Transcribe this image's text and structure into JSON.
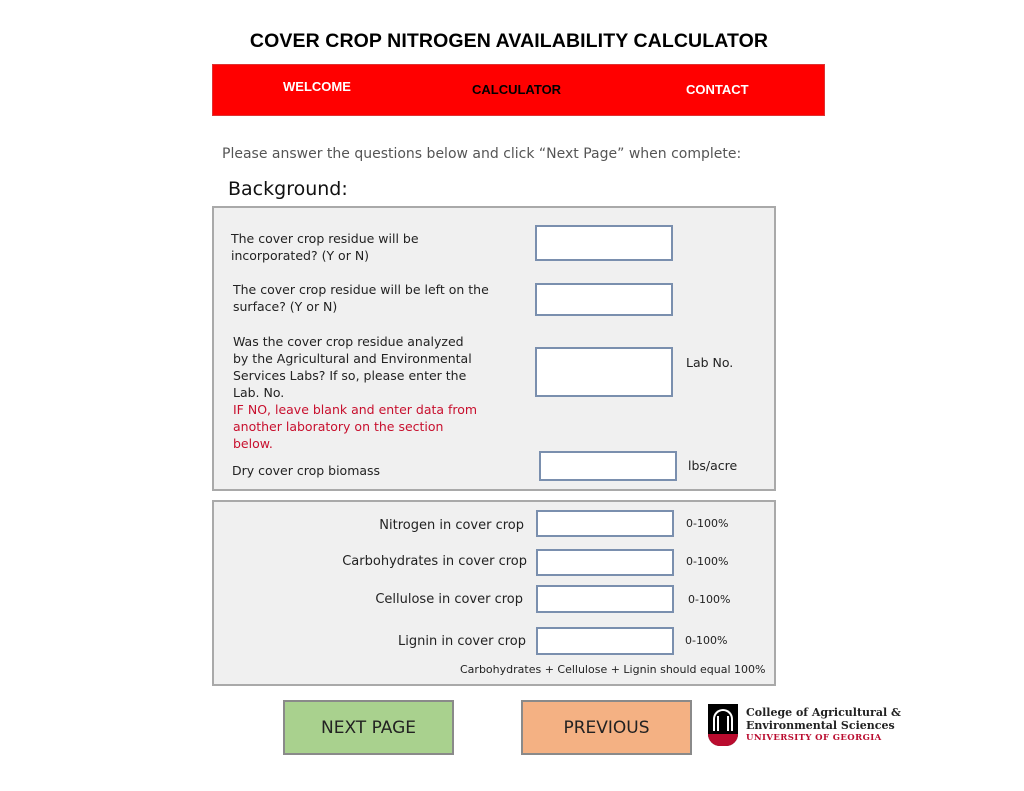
{
  "page": {
    "title": "COVER CROP NITROGEN AVAILABILITY CALCULATOR"
  },
  "nav": {
    "items": [
      {
        "label": "WELCOME"
      },
      {
        "label": "CALCULATOR",
        "active": true
      },
      {
        "label": "CONTACT"
      }
    ],
    "color": "#ff0000"
  },
  "instructions": "Please answer the questions below and click “Next Page” when complete:",
  "section_title": "Background:",
  "background_panel": {
    "q_incorporated": {
      "line1": "The cover crop residue will be",
      "line2": "incorporated? (Y or N)",
      "value": ""
    },
    "q_surface": {
      "line1": "The cover crop residue will be left on the",
      "line2": "surface? (Y or N)",
      "value": ""
    },
    "q_lab": {
      "line1": "Was the cover crop residue analyzed",
      "line2": "by the Agricultural and Environmental",
      "line3": "Services Labs? If so, please enter the",
      "line4": "Lab. No.",
      "warn1": "IF NO, leave blank and enter data from",
      "warn2": "another laboratory on the section",
      "warn3": "below.",
      "unit": "Lab No.",
      "value": ""
    },
    "q_biomass": {
      "label": "Dry cover crop biomass",
      "unit": "lbs/acre",
      "value": ""
    }
  },
  "composition_panel": {
    "fields": [
      {
        "label": "Nitrogen in cover crop",
        "range": "0-100%",
        "value": ""
      },
      {
        "label": "Carbohydrates in cover crop",
        "range": "0-100%",
        "value": ""
      },
      {
        "label": "Cellulose in cover crop",
        "range": "0-100%",
        "value": ""
      },
      {
        "label": "Lignin in cover crop",
        "range": "0-100%",
        "value": ""
      }
    ],
    "note": "Carbohydrates + Cellulose + Lignin should equal 100%"
  },
  "buttons": {
    "next": {
      "label": "NEXT PAGE",
      "color": "#a9d18e"
    },
    "previous": {
      "label": "PREVIOUS",
      "color": "#f4b183"
    }
  },
  "logo": {
    "line1": "College of Agricultural &",
    "line2": "Environmental Sciences",
    "line3": "UNIVERSITY OF GEORGIA",
    "accent": "#ba0c2f"
  }
}
